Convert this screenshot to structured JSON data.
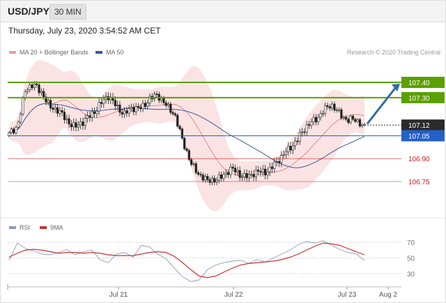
{
  "header": {
    "symbol": "USD/JPY",
    "timeframe": "30 MIN"
  },
  "timestamp": "Thursday, July 23, 2020 3:54:52 AM CET",
  "watermark": "Research © 2020 Trading Central",
  "colors": {
    "green_level": "#5aa000",
    "red_level": "#c81e1e",
    "blue_level": "#2560c8",
    "current": "#2b2b2b",
    "ma50": "#3c5a96",
    "ma20": "#e07070",
    "bands": "#fadada",
    "rsi": "#8a9ab8",
    "rsi_ma": "#c83232",
    "arrow": "#2e6ea4"
  },
  "chart_data": [
    {
      "type": "candlestick",
      "legend": [
        "MA 20 + Bollinger Bands",
        "MA 50"
      ],
      "x_ticks": [
        "Jul 21",
        "Jul 22",
        "Jul 23",
        "Aug 2"
      ],
      "ylim": [
        106.6,
        107.53
      ],
      "levels": [
        {
          "label": "107.40",
          "value": 107.4,
          "kind": "resistance"
        },
        {
          "label": "107.30",
          "value": 107.3,
          "kind": "resistance"
        },
        {
          "label": "107.12",
          "value": 107.12,
          "kind": "current"
        },
        {
          "label": "107.05",
          "value": 107.05,
          "kind": "pivot"
        },
        {
          "label": "106.90",
          "value": 106.9,
          "kind": "support"
        },
        {
          "label": "106.75",
          "value": 106.75,
          "kind": "support"
        }
      ],
      "close_path": [
        107.05,
        107.12,
        107.36,
        107.37,
        107.34,
        107.24,
        107.2,
        107.16,
        107.11,
        107.13,
        107.2,
        107.26,
        107.3,
        107.25,
        107.2,
        107.22,
        107.24,
        107.3,
        107.3,
        107.26,
        107.2,
        107.0,
        106.88,
        106.8,
        106.74,
        106.77,
        106.8,
        106.82,
        106.8,
        106.79,
        106.8,
        106.82,
        106.86,
        106.9,
        106.98,
        107.04,
        107.1,
        107.16,
        107.22,
        107.24,
        107.2,
        107.16,
        107.14,
        107.11
      ],
      "forecast": {
        "from": 107.11,
        "to": 107.4
      }
    },
    {
      "type": "line",
      "legend": [
        "RSI",
        "9MA"
      ],
      "y_ticks": [
        70,
        50,
        30
      ],
      "x_ticks": [
        "Jul 21",
        "Jul 22",
        "Jul 23",
        "Aug 2"
      ],
      "ylim": [
        18,
        78
      ],
      "series": [
        {
          "name": "RSI",
          "values": [
            47,
            69,
            62,
            59,
            55,
            54,
            57,
            61,
            54,
            58,
            60,
            48,
            44,
            55,
            57,
            51,
            66,
            64,
            55,
            49,
            37,
            26,
            20,
            22,
            35,
            41,
            44,
            46,
            47,
            43,
            48,
            45,
            50,
            55,
            60,
            67,
            71,
            69,
            72,
            66,
            61,
            57,
            55,
            47
          ]
        },
        {
          "name": "9MA",
          "values": [
            51,
            56,
            60,
            61,
            60,
            58,
            56,
            57,
            57,
            56,
            57,
            56,
            54,
            53,
            53,
            53,
            55,
            57,
            58,
            57,
            52,
            44,
            35,
            27,
            25,
            27,
            32,
            37,
            41,
            43,
            44,
            45,
            46,
            48,
            51,
            55,
            60,
            65,
            69,
            68,
            66,
            62,
            58,
            54
          ]
        }
      ]
    }
  ]
}
